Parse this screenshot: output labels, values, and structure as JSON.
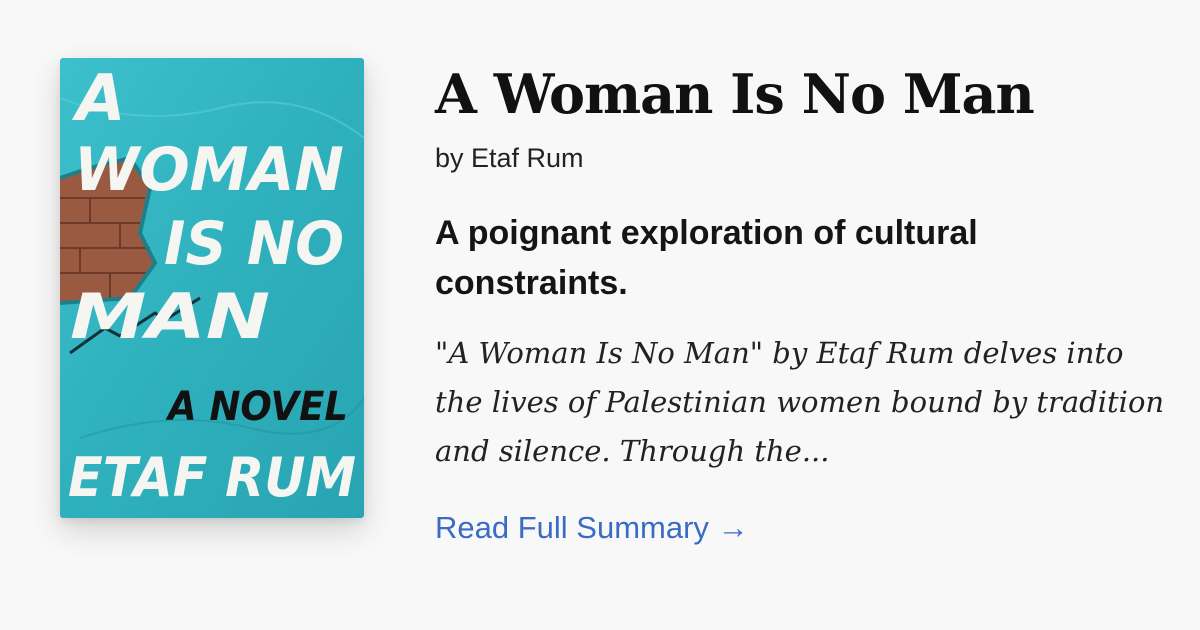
{
  "book": {
    "title": "A Woman Is No Man",
    "author_line": "by Etaf Rum",
    "tagline": "A poignant exploration of cultural constraints.",
    "summary": "\"A Woman Is No Man\" by Etaf Rum delves into the lives of Palestinian women bound by tradition and silence. Through the...",
    "read_more_label": "Read Full Summary →"
  },
  "cover": {
    "text_lines": [
      "A",
      "WOMAN",
      "IS NO",
      "MAN",
      "A NOVEL",
      "ETAF RUM"
    ],
    "colors": {
      "background": "#2fb1bd",
      "lettering": "#f5f5f2",
      "accent_text": "#111111",
      "brick": "#9a5a42"
    }
  },
  "colors": {
    "page_background": "#f8f8f8",
    "link": "#3a6cc5"
  }
}
